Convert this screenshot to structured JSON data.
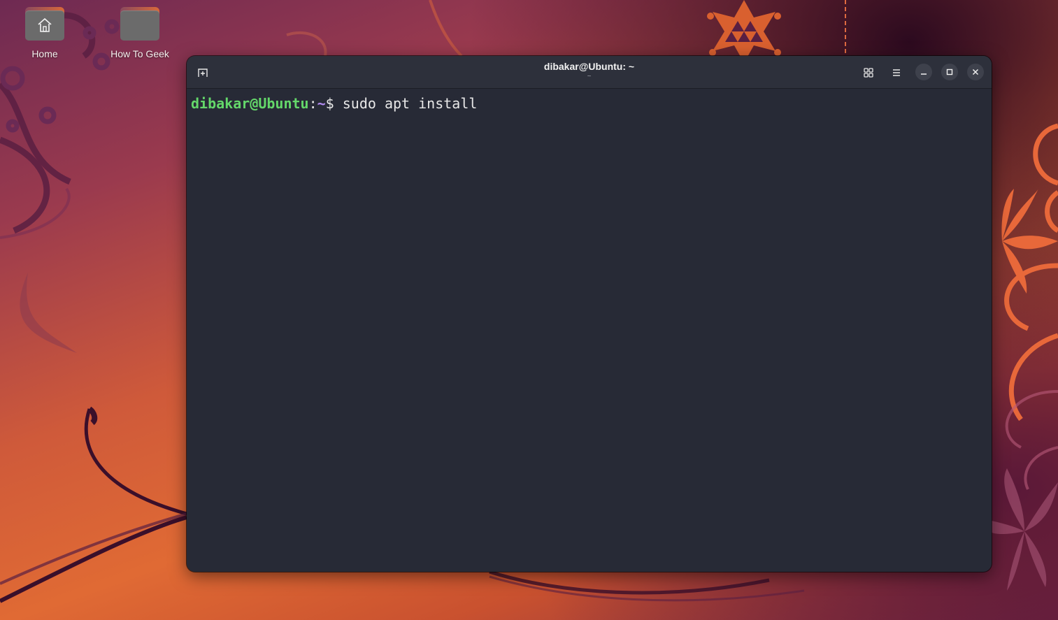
{
  "desktop": {
    "icons": [
      {
        "label": "Home",
        "icon": "home-folder-icon"
      },
      {
        "label": "How To Geek",
        "icon": "folder-icon"
      }
    ]
  },
  "terminal": {
    "title": "dibakar@Ubuntu: ~",
    "subtitle": "~",
    "prompt": {
      "user_host": "dibakar@Ubuntu",
      "separator": ":",
      "directory": "~",
      "symbol": "$",
      "command": " sudo apt install"
    },
    "icons": {
      "new_tab": "new-tab-icon",
      "view": "grid-view-icon",
      "menu": "hamburger-menu-icon",
      "minimize": "minimize-icon",
      "maximize": "maximize-icon",
      "close": "close-icon"
    }
  },
  "colors": {
    "terminal_bg": "#272a36",
    "headerbar_bg": "#2d303b",
    "prompt_user": "#64d86a",
    "prompt_dir": "#b38cf2",
    "text": "#e8e8e8"
  }
}
